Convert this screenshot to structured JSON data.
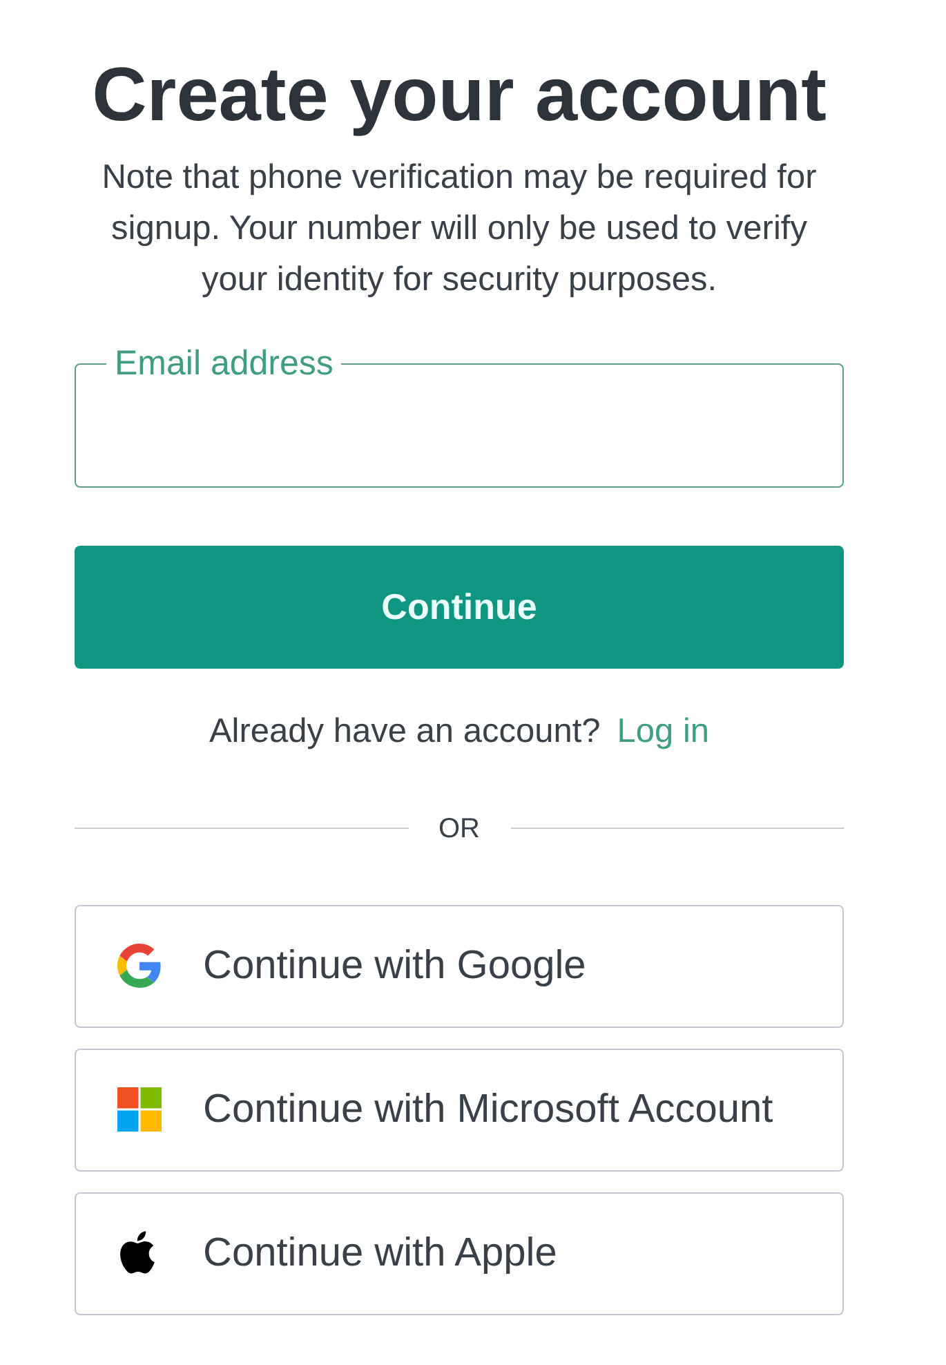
{
  "title": "Create your account",
  "note": "Note that phone verification may be required for signup. Your number will only be used to verify your identity for security purposes.",
  "email_field": {
    "label": "Email address"
  },
  "continue_button": {
    "label": "Continue"
  },
  "login_prompt": {
    "text": "Already have an account?",
    "link": "Log in"
  },
  "divider": {
    "label": "OR"
  },
  "social_buttons": [
    {
      "kind": "google",
      "label": "Continue with Google"
    },
    {
      "kind": "microsoft",
      "label": "Continue with Microsoft Account"
    },
    {
      "kind": "apple",
      "label": "Continue with Apple"
    }
  ]
}
